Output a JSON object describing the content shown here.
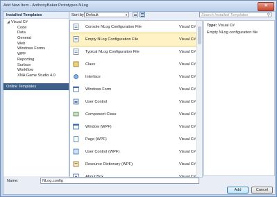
{
  "window": {
    "title": "Add New Item - AnthonyBaker.Prototypes.NLog",
    "close_glyph": "×"
  },
  "left": {
    "installed_header": "Installed Templates",
    "root": {
      "arrow": "◢",
      "label": "Visual C#"
    },
    "children": [
      "Code",
      "Data",
      "General",
      "Web",
      "Windows Forms",
      "WPF",
      "Reporting",
      "Surface",
      "Workflow",
      "XNA Game Studio 4.0"
    ],
    "online_header": "Online Templates"
  },
  "toolbar": {
    "sort_label": "Sort by:",
    "sort_value": "Default",
    "search_placeholder": "Search Installed Templates"
  },
  "templates": [
    {
      "name": "Console NLog Configuration File",
      "lang": "Visual C#",
      "icon": "config-file-icon"
    },
    {
      "name": "Empty NLog Configuration File",
      "lang": "Visual C#",
      "icon": "config-file-icon",
      "selected": true
    },
    {
      "name": "Typical NLog Configuration File",
      "lang": "Visual C#",
      "icon": "config-file-icon"
    },
    {
      "name": "Class",
      "lang": "Visual C#",
      "icon": "class-icon"
    },
    {
      "name": "Interface",
      "lang": "Visual C#",
      "icon": "interface-icon"
    },
    {
      "name": "Windows Form",
      "lang": "Visual C#",
      "icon": "windows-form-icon"
    },
    {
      "name": "User Control",
      "lang": "Visual C#",
      "icon": "user-control-icon"
    },
    {
      "name": "Component Class",
      "lang": "Visual C#",
      "icon": "component-class-icon"
    },
    {
      "name": "Window (WPF)",
      "lang": "Visual C#",
      "icon": "wpf-window-icon"
    },
    {
      "name": "Page (WPF)",
      "lang": "Visual C#",
      "icon": "wpf-page-icon"
    },
    {
      "name": "User Control (WPF)",
      "lang": "Visual C#",
      "icon": "wpf-user-control-icon"
    },
    {
      "name": "Resource Dictionary (WPF)",
      "lang": "Visual C#",
      "icon": "resource-dictionary-icon"
    },
    {
      "name": "About Box",
      "lang": "Visual C#",
      "icon": "about-box-icon"
    }
  ],
  "detail": {
    "type_label": "Type:",
    "type_value": "Visual C#",
    "description": "Empty NLog configuration file"
  },
  "bottom": {
    "name_label": "Name:",
    "name_value": "NLog.config",
    "add_label": "Add",
    "cancel_label": "Cancel"
  },
  "colors": {
    "selected_row": "#fff3c6",
    "online_header": "#3d5f88",
    "window_frame": "#c4d5ec"
  }
}
